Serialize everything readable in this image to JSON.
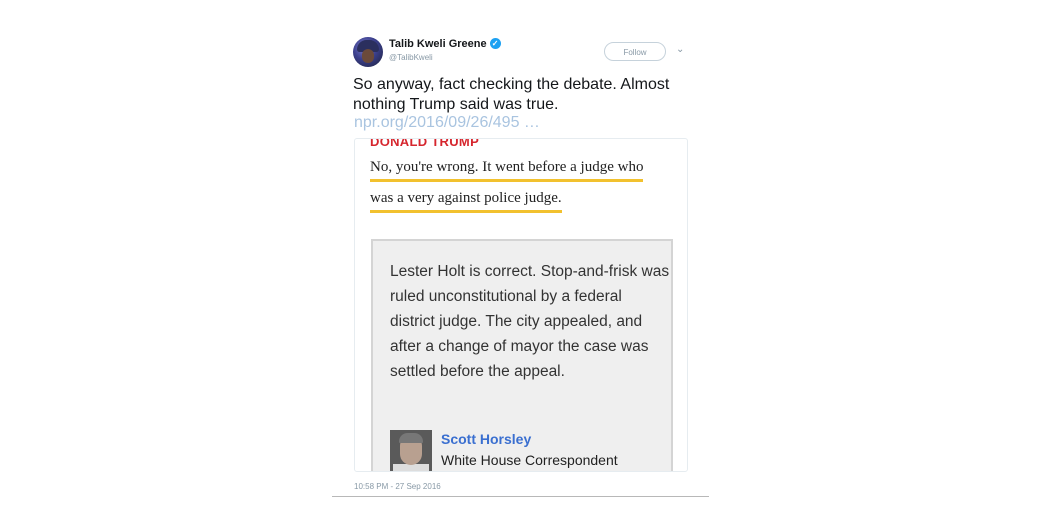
{
  "user": {
    "display_name": "Talib Kweli Greene",
    "handle": "@TalibKweli",
    "verified": true
  },
  "follow_label": "Follow",
  "tweet": {
    "text": "So anyway, fact checking the debate. Almost nothing Trump said was true.",
    "link": "npr.org/2016/09/26/495 …",
    "timestamp": "10:58 PM - 27 Sep 2016"
  },
  "card": {
    "speaker": "DONALD TRUMP",
    "quote_line_1": "No,  you're wrong. It went before a judge who",
    "quote_line_2": "was a very against police judge.",
    "analysis": "Lester Holt is correct. Stop-and-frisk was ruled unconstitutional by a federal district judge. The city appealed, and after a change of mayor the case was settled before the appeal.",
    "author_name": "Scott Horsley",
    "author_title": "White House Correspondent"
  },
  "colors": {
    "highlight": "#f2c12e",
    "speaker": "#d6262e",
    "author_link": "#3a6fd0",
    "verified": "#1da1f2"
  }
}
